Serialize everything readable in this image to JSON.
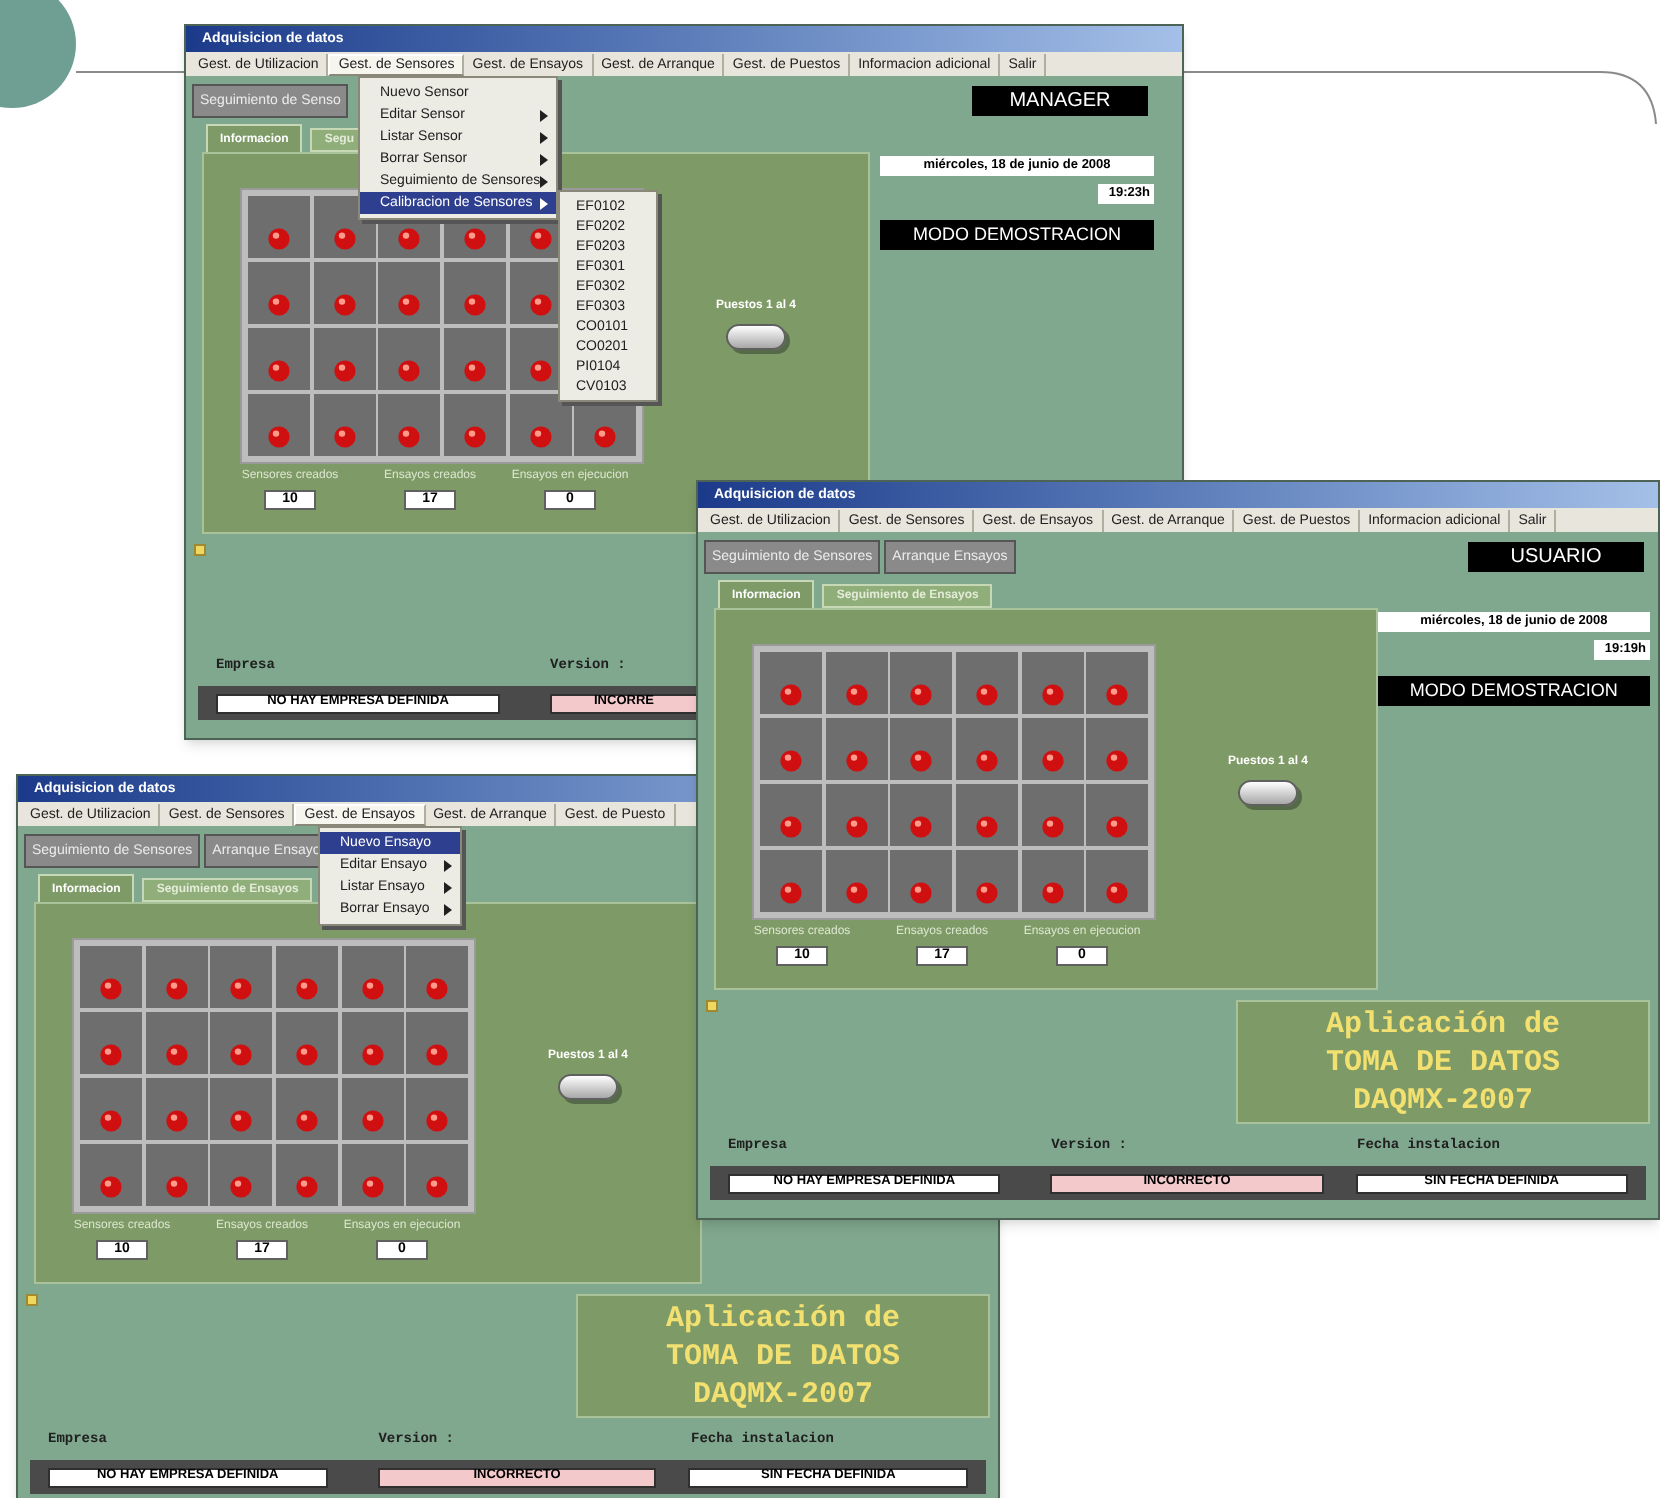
{
  "windows": [
    {
      "title": "Adquisicion de datos",
      "menu": [
        {
          "label": "Gest. de Utilizacion",
          "selected": false
        },
        {
          "label": "Gest. de Sensores",
          "selected": true
        },
        {
          "label": "Gest. de Ensayos",
          "selected": false
        },
        {
          "label": "Gest. de Arranque",
          "selected": false
        },
        {
          "label": "Gest. de Puestos",
          "selected": false
        },
        {
          "label": "Informacion adicional",
          "selected": false
        },
        {
          "label": "Salir",
          "selected": false
        }
      ],
      "dropdown": {
        "items": [
          {
            "label": "Nuevo Sensor",
            "has_submenu": false,
            "selected": false
          },
          {
            "label": "Editar Sensor",
            "has_submenu": true,
            "selected": false
          },
          {
            "label": "Listar Sensor",
            "has_submenu": true,
            "selected": false
          },
          {
            "label": "Borrar Sensor",
            "has_submenu": true,
            "selected": false
          },
          {
            "label": "Seguimiento de Sensores",
            "has_submenu": true,
            "selected": false
          },
          {
            "label": "Calibracion de Sensores",
            "has_submenu": true,
            "selected": true
          }
        ],
        "submenu": [
          "EF0102",
          "EF0202",
          "EF0203",
          "EF0301",
          "EF0302",
          "EF0303",
          "CO0101",
          "CO0201",
          "PI0104",
          "CV0103"
        ]
      },
      "buttons": [
        "Seguimiento de Senso"
      ],
      "role": "MANAGER",
      "tabs": [
        {
          "label": "Informacion",
          "selected": true
        },
        {
          "label": "Segu",
          "selected": false
        }
      ],
      "puestos": "Puestos 1 al 4",
      "counters": [
        {
          "label": "Sensores creados",
          "value": "10"
        },
        {
          "label": "Ensayos creados",
          "value": "17"
        },
        {
          "label": "Ensayos en ejecucion",
          "value": "0"
        }
      ],
      "date": "miércoles, 18 de junio de 2008",
      "time": "19:23h",
      "mode": "MODO DEMOSTRACION",
      "footer": [
        {
          "label": "Empresa",
          "value": "NO HAY EMPRESA DEFINIDA",
          "color": "#ffffff"
        },
        {
          "label": "Version :",
          "value": "INCORRE",
          "color": "#f4c9cc"
        }
      ]
    },
    {
      "title": "Adquisicion de datos",
      "menu": [
        {
          "label": "Gest. de Utilizacion",
          "selected": false
        },
        {
          "label": "Gest. de Sensores",
          "selected": false
        },
        {
          "label": "Gest. de Ensayos",
          "selected": false
        },
        {
          "label": "Gest. de Arranque",
          "selected": false
        },
        {
          "label": "Gest. de Puestos",
          "selected": false
        },
        {
          "label": "Informacion adicional",
          "selected": false
        },
        {
          "label": "Salir",
          "selected": false
        }
      ],
      "buttons": [
        "Seguimiento de Sensores",
        "Arranque Ensayos"
      ],
      "role": "USUARIO",
      "tabs": [
        {
          "label": "Informacion",
          "selected": true
        },
        {
          "label": "Seguimiento de Ensayos",
          "selected": false
        }
      ],
      "puestos": "Puestos 1 al 4",
      "counters": [
        {
          "label": "Sensores creados",
          "value": "10"
        },
        {
          "label": "Ensayos creados",
          "value": "17"
        },
        {
          "label": "Ensayos en ejecucion",
          "value": "0"
        }
      ],
      "date": "miércoles, 18 de junio de 2008",
      "time": "19:19h",
      "mode": "MODO DEMOSTRACION",
      "app_title": [
        "Aplicación de",
        "TOMA DE DATOS",
        "DAQMX-2007"
      ],
      "footer": [
        {
          "label": "Empresa",
          "value": "NO HAY EMPRESA DEFINIDA",
          "color": "#ffffff"
        },
        {
          "label": "Version :",
          "value": "INCORRECTO",
          "color": "#f4c9cc"
        },
        {
          "label": "Fecha instalacion",
          "value": "SIN FECHA DEFINIDA",
          "color": "#ffffff"
        }
      ]
    },
    {
      "title": "Adquisicion de datos",
      "menu": [
        {
          "label": "Gest. de Utilizacion",
          "selected": false
        },
        {
          "label": "Gest. de Sensores",
          "selected": false
        },
        {
          "label": "Gest. de Ensayos",
          "selected": true
        },
        {
          "label": "Gest. de Arranque",
          "selected": false
        },
        {
          "label": "Gest. de Puesto",
          "selected": false
        }
      ],
      "dropdown": {
        "items": [
          {
            "label": "Nuevo Ensayo",
            "has_submenu": false,
            "selected": true
          },
          {
            "label": "Editar Ensayo",
            "has_submenu": true,
            "selected": false
          },
          {
            "label": "Listar Ensayo",
            "has_submenu": true,
            "selected": false
          },
          {
            "label": "Borrar Ensayo",
            "has_submenu": true,
            "selected": false
          }
        ]
      },
      "buttons": [
        "Seguimiento de Sensores",
        "Arranque Ensayo"
      ],
      "tabs": [
        {
          "label": "Informacion",
          "selected": true
        },
        {
          "label": "Seguimiento de Ensayos",
          "selected": false
        }
      ],
      "puestos": "Puestos 1 al 4",
      "counters": [
        {
          "label": "Sensores creados",
          "value": "10"
        },
        {
          "label": "Ensayos creados",
          "value": "17"
        },
        {
          "label": "Ensayos en ejecucion",
          "value": "0"
        }
      ],
      "app_title": [
        "Aplicación de",
        "TOMA DE DATOS",
        "DAQMX-2007"
      ],
      "footer": [
        {
          "label": "Empresa",
          "value": "NO HAY EMPRESA DEFINIDA",
          "color": "#ffffff"
        },
        {
          "label": "Version :",
          "value": "INCORRECTO",
          "color": "#f4c9cc"
        },
        {
          "label": "Fecha instalacion",
          "value": "SIN FECHA DEFINIDA",
          "color": "#ffffff"
        }
      ]
    }
  ]
}
